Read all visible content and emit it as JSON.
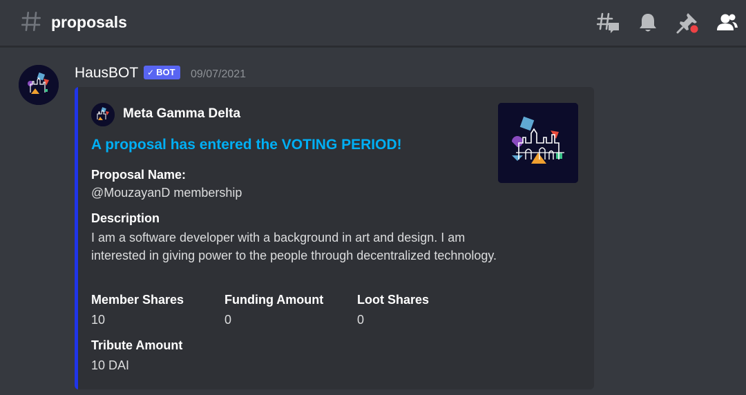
{
  "header": {
    "channel_name": "proposals",
    "icons": [
      "hash-icon",
      "threads-icon",
      "bell-icon",
      "pin-icon",
      "members-icon"
    ]
  },
  "message": {
    "author": "HausBOT",
    "bot_tag": "BOT",
    "timestamp": "09/07/2021",
    "embed": {
      "accent_color": "#2035e8",
      "author_name": "Meta Gamma Delta",
      "title": "A proposal has entered the VOTING PERIOD!",
      "fields": {
        "proposal_name": {
          "name": "Proposal Name:",
          "value": "@MouzayanD membership"
        },
        "description": {
          "name": "Description",
          "value": "I am a software developer with a background in art and design. I am interested in giving power to the people through decentralized technology."
        },
        "member_shares": {
          "name": "Member Shares",
          "value": "10"
        },
        "funding_amount": {
          "name": "Funding Amount",
          "value": "0"
        },
        "loot_shares": {
          "name": "Loot Shares",
          "value": "0"
        },
        "tribute_amount": {
          "name": "Tribute Amount",
          "value": "10 DAI"
        }
      }
    }
  },
  "colors": {
    "background": "#36393f",
    "embed_background": "#2f3136",
    "link": "#00aff4",
    "bot_tag": "#5865f2",
    "notification_dot": "#ed4245"
  }
}
